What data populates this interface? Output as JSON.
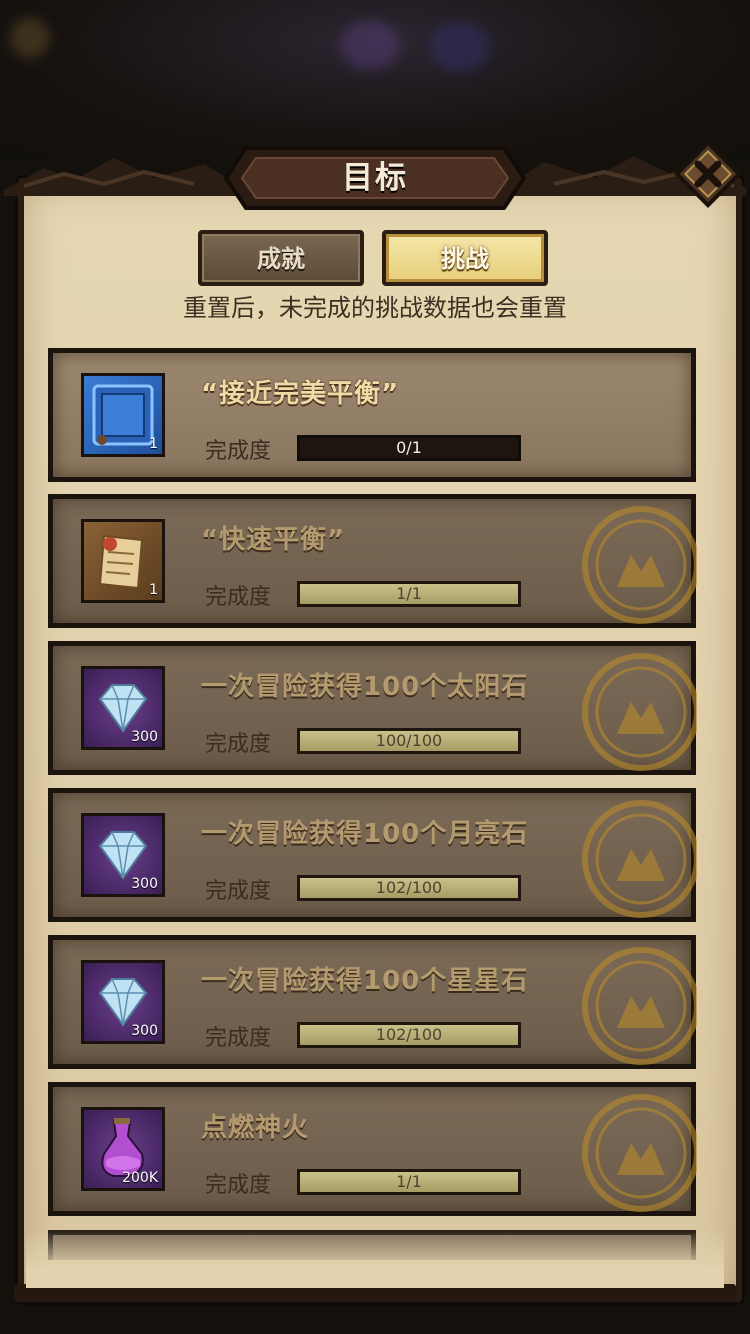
{
  "header": {
    "title": "目标"
  },
  "tabs": [
    {
      "label": "成就",
      "active": false
    },
    {
      "label": "挑战",
      "active": true
    }
  ],
  "notice": "重置后，未完成的挑战数据也会重置",
  "progress_label": "完成度",
  "challenges": [
    {
      "title": "“接近完美平衡”",
      "icon": "blue-frame-icon",
      "badge": "1",
      "progress_text": "0/1",
      "progress_fraction": 0.0,
      "completed": false
    },
    {
      "title": "“快速平衡”",
      "icon": "scroll-certificate-icon",
      "badge": "1",
      "progress_text": "1/1",
      "progress_fraction": 1.0,
      "completed": true
    },
    {
      "title": "一次冒险获得100个太阳石",
      "icon": "diamond-icon",
      "badge": "300",
      "progress_text": "100/100",
      "progress_fraction": 1.0,
      "completed": true
    },
    {
      "title": "一次冒险获得100个月亮石",
      "icon": "diamond-icon",
      "badge": "300",
      "progress_text": "102/100",
      "progress_fraction": 1.0,
      "completed": true
    },
    {
      "title": "一次冒险获得100个星星石",
      "icon": "diamond-icon",
      "badge": "300",
      "progress_text": "102/100",
      "progress_fraction": 1.0,
      "completed": true
    },
    {
      "title": "点燃神火",
      "icon": "potion-flask-icon",
      "badge": "200K",
      "progress_text": "1/1",
      "progress_fraction": 1.0,
      "completed": true
    }
  ],
  "colors": {
    "parchment": "#e2d2ad",
    "card": "#8a765e",
    "bar_fill": "#c9c18a",
    "active_tab": "#f0dc8c"
  }
}
